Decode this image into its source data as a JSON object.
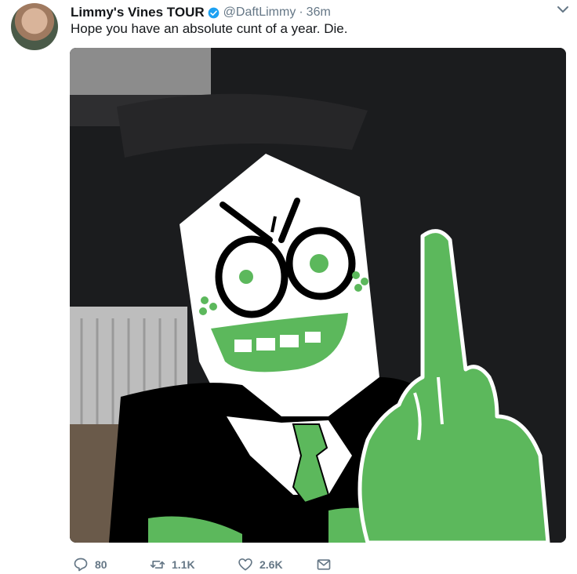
{
  "tweet": {
    "author_name": "Limmy's Vines TOUR",
    "handle": "@DaftLimmy",
    "separator": "·",
    "time": "36m",
    "text": "Hope you have an absolute cunt of a year. Die."
  },
  "actions": {
    "replies": "80",
    "retweets": "1.1K",
    "likes": "2.6K"
  },
  "icons": {
    "verified": "verified-badge-icon",
    "menu": "chevron-down-icon",
    "reply": "reply-icon",
    "retweet": "retweet-icon",
    "like": "heart-icon",
    "dm": "envelope-icon"
  },
  "colors": {
    "verified": "#1da1f2",
    "muted": "#657786",
    "drawing_green": "#5cb85c"
  }
}
